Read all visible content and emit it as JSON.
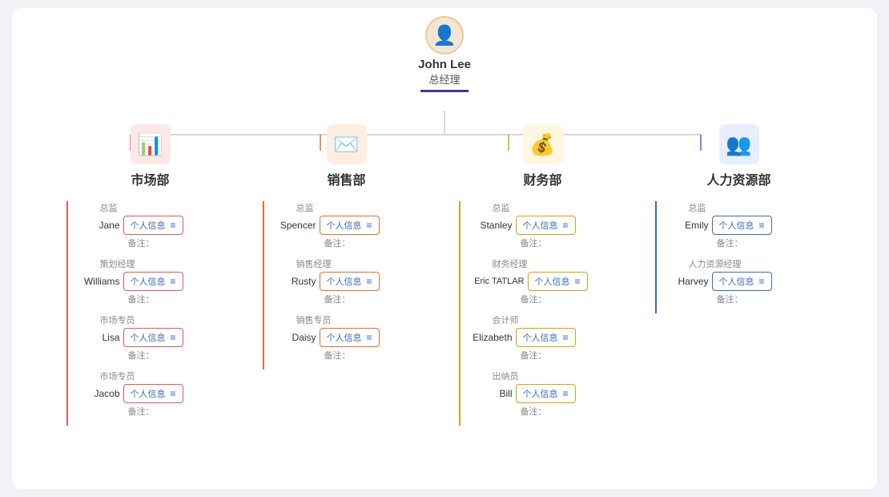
{
  "ceo": {
    "name": "John Lee",
    "title": "总经理",
    "avatar": "👤"
  },
  "departments": [
    {
      "id": "market",
      "name": "市场部",
      "icon": "📊",
      "colorClass": "dept-market",
      "iconClass": "dept-icon-market",
      "employees": [
        {
          "role": "总监",
          "name": "Jane",
          "card": "个人信息",
          "note": "备注："
        },
        {
          "role": "策划经理",
          "name": "Williams",
          "card": "个人信息",
          "note": "备注："
        },
        {
          "role": "市场专员",
          "name": "Lisa",
          "card": "个人信息",
          "note": "备注："
        },
        {
          "role": "市场专员",
          "name": "Jacob",
          "card": "个人信息",
          "note": "备注："
        }
      ]
    },
    {
      "id": "sales",
      "name": "销售部",
      "icon": "✉️",
      "colorClass": "dept-sales",
      "iconClass": "dept-icon-sales",
      "employees": [
        {
          "role": "总监",
          "name": "Spencer",
          "card": "个人信息",
          "note": "备注："
        },
        {
          "role": "销售经理",
          "name": "Rusty",
          "card": "个人信息",
          "note": "备注："
        },
        {
          "role": "销售专员",
          "name": "Daisy",
          "card": "个人信息",
          "note": "备注："
        }
      ]
    },
    {
      "id": "finance",
      "name": "财务部",
      "icon": "💰",
      "colorClass": "dept-finance",
      "iconClass": "dept-icon-finance",
      "employees": [
        {
          "role": "总监",
          "name": "Stanley",
          "card": "个人信息",
          "note": "备注："
        },
        {
          "role": "财务经理",
          "name": "Eric TATLAR",
          "card": "个人信息",
          "note": "备注："
        },
        {
          "role": "会计师",
          "name": "Elizabeth",
          "card": "个人信息",
          "note": "备注："
        },
        {
          "role": "出纳员",
          "name": "Bill",
          "card": "个人信息",
          "note": "备注："
        }
      ]
    },
    {
      "id": "hr",
      "name": "人力资源部",
      "icon": "👥",
      "colorClass": "dept-hr",
      "iconClass": "dept-icon-hr",
      "employees": [
        {
          "role": "总监",
          "name": "Emily",
          "card": "个人信息",
          "note": "备注："
        },
        {
          "role": "人力资源经理",
          "name": "Harvey",
          "card": "个人信息",
          "note": "备注："
        }
      ]
    }
  ]
}
